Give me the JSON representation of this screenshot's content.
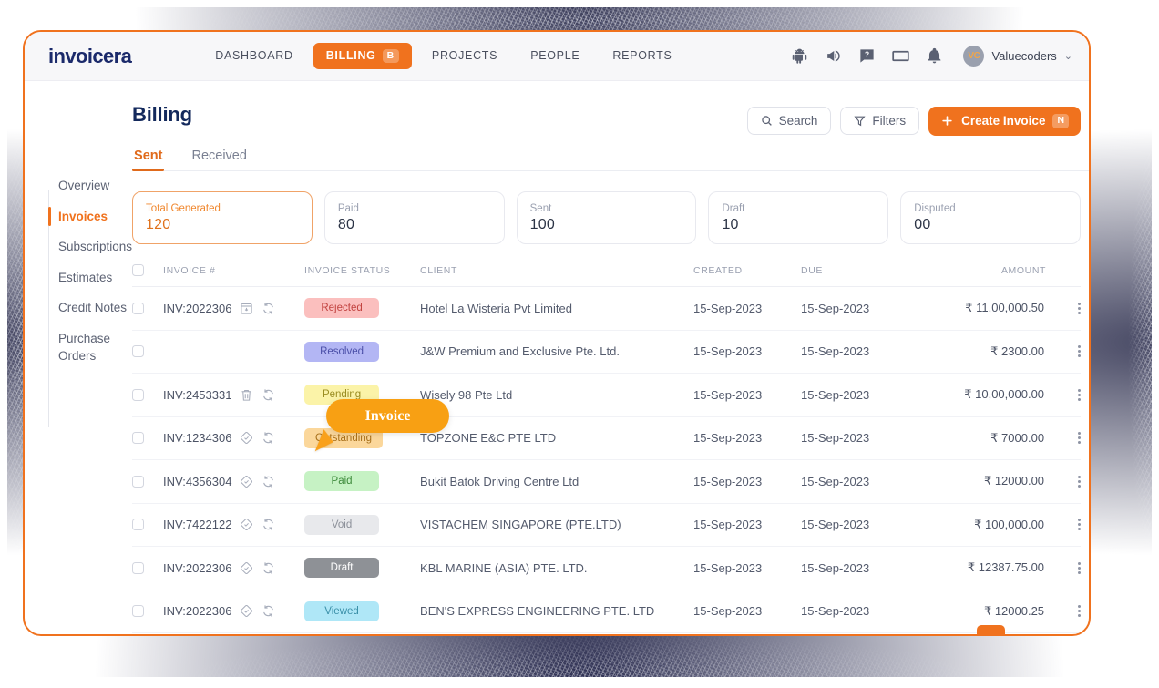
{
  "brand": {
    "name": "invoicera"
  },
  "topnav": {
    "links": [
      {
        "label": "DASHBOARD",
        "active": false,
        "chip": ""
      },
      {
        "label": "BILLING",
        "active": true,
        "chip": "B"
      },
      {
        "label": "PROJECTS",
        "active": false,
        "chip": ""
      },
      {
        "label": "PEOPLE",
        "active": false,
        "chip": ""
      },
      {
        "label": "REPORTS",
        "active": false,
        "chip": ""
      }
    ],
    "icons": [
      "android-icon",
      "megaphone-icon",
      "help-icon",
      "keyboard-icon",
      "bell-icon"
    ],
    "user": {
      "initials": "VC",
      "name": "Valuecoders",
      "caret": "⌄"
    }
  },
  "sidebar": {
    "items": [
      {
        "label": "Overview",
        "active": false
      },
      {
        "label": "Invoices",
        "active": true
      },
      {
        "label": "Subscriptions",
        "active": false
      },
      {
        "label": "Estimates",
        "active": false
      },
      {
        "label": "Credit Notes",
        "active": false
      },
      {
        "label": "Purchase Orders",
        "active": false
      }
    ]
  },
  "page": {
    "title": "Billing",
    "search_label": "Search",
    "filters_label": "Filters",
    "create_label": "Create Invoice",
    "create_chip": "N",
    "plus": "+"
  },
  "tabs": [
    {
      "label": "Sent",
      "active": true
    },
    {
      "label": "Received",
      "active": false
    }
  ],
  "stats": [
    {
      "label": "Total Generated",
      "value": "120",
      "active": true
    },
    {
      "label": "Paid",
      "value": "80",
      "active": false
    },
    {
      "label": "Sent",
      "value": "100",
      "active": false
    },
    {
      "label": "Draft",
      "value": "10",
      "active": false
    },
    {
      "label": "Disputed",
      "value": "00",
      "active": false
    }
  ],
  "table": {
    "headers": {
      "invoice": "INVOICE #",
      "status": "INVOICE STATUS",
      "client": "CLIENT",
      "created": "CREATED",
      "due": "DUE",
      "amount": "AMOUNT"
    },
    "rows": [
      {
        "invoice_no": "INV:2022306",
        "icon1": "archive-download-icon",
        "icon2": "refresh-icon",
        "status": "Rejected",
        "status_bg": "#FBBFBE",
        "status_fg": "#C24340",
        "client": "Hotel La Wisteria Pvt Limited",
        "created": "15-Sep-2023",
        "due": "15-Sep-2023",
        "amount": "₹ 11,00,000.50"
      },
      {
        "invoice_no": "",
        "icon1": "",
        "icon2": "",
        "status": "Resolved",
        "status_bg": "#B3B6F4",
        "status_fg": "#4B4FA8",
        "client": "J&W Premium and Exclusive Pte. Ltd.",
        "created": "15-Sep-2023",
        "due": "15-Sep-2023",
        "amount": "₹ 2300.00"
      },
      {
        "invoice_no": "INV:2453331",
        "icon1": "trash-icon",
        "icon2": "refresh-icon",
        "status": "Pending",
        "status_bg": "#FBF3A8",
        "status_fg": "#9A8D22",
        "client": "Wisely 98 Pte Ltd",
        "created": "15-Sep-2023",
        "due": "15-Sep-2023",
        "amount": "₹ 10,00,000.00"
      },
      {
        "invoice_no": "INV:1234306",
        "icon1": "diamond-check-icon",
        "icon2": "refresh-icon",
        "status": "Outstanding",
        "status_bg": "#FBD79B",
        "status_fg": "#A8701B",
        "client": "TOPZONE E&C PTE LTD",
        "created": "15-Sep-2023",
        "due": "15-Sep-2023",
        "amount": "₹ 7000.00"
      },
      {
        "invoice_no": "INV:4356304",
        "icon1": "diamond-check-icon",
        "icon2": "refresh-icon",
        "status": "Paid",
        "status_bg": "#C6F2C4",
        "status_fg": "#3E8B3C",
        "client": "Bukit Batok Driving Centre Ltd",
        "created": "15-Sep-2023",
        "due": "15-Sep-2023",
        "amount": "₹ 12000.00"
      },
      {
        "invoice_no": "INV:7422122",
        "icon1": "diamond-check-icon",
        "icon2": "refresh-icon",
        "status": "Void",
        "status_bg": "#E8E9EC",
        "status_fg": "#8C9099",
        "client": "VISTACHEM SINGAPORE (PTE.LTD)",
        "created": "15-Sep-2023",
        "due": "15-Sep-2023",
        "amount": "₹ 100,000.00"
      },
      {
        "invoice_no": "INV:2022306",
        "icon1": "diamond-check-icon",
        "icon2": "refresh-icon",
        "status": "Draft",
        "status_bg": "#8E9196",
        "status_fg": "#FFFFFF",
        "client": "KBL MARINE (ASIA) PTE. LTD.",
        "created": "15-Sep-2023",
        "due": "15-Sep-2023",
        "amount": "₹ 12387.75.00"
      },
      {
        "invoice_no": "INV:2022306",
        "icon1": "diamond-check-icon",
        "icon2": "refresh-icon",
        "status": "Viewed",
        "status_bg": "#AFE7F7",
        "status_fg": "#3A8FA8",
        "client": "BEN'S EXPRESS ENGINEERING PTE. LTD",
        "created": "15-Sep-2023",
        "due": "15-Sep-2023",
        "amount": "₹ 12000.25"
      }
    ]
  },
  "overlay": {
    "tooltip_label": "Invoice"
  },
  "colors": {
    "accent": "#F0721E",
    "tooltip": "#F8A013",
    "title": "#13295C"
  }
}
